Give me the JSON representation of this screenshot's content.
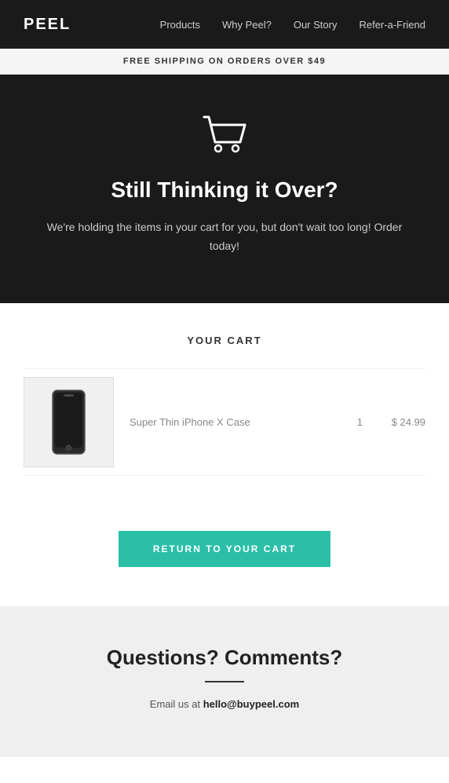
{
  "header": {
    "logo": "PEEL",
    "nav": {
      "items": [
        {
          "label": "Products",
          "href": "#"
        },
        {
          "label": "Why Peel?",
          "href": "#"
        },
        {
          "label": "Our Story",
          "href": "#"
        },
        {
          "label": "Refer-a-Friend",
          "href": "#"
        }
      ]
    }
  },
  "banner": {
    "text": "FREE SHIPPING ON ORDERS OVER $49"
  },
  "hero": {
    "title": "Still Thinking it Over?",
    "subtitle": "We're holding the items in your cart for you, but don't wait too long! Order today!"
  },
  "cart": {
    "section_title": "YOUR CART",
    "items": [
      {
        "name": "Super Thin iPhone X Case",
        "qty": "1",
        "price": "$ 24.99"
      }
    ]
  },
  "cta": {
    "button_label": "RETURN TO YOUR CART"
  },
  "footer": {
    "heading": "Questions? Comments?",
    "text_prefix": "Email us at ",
    "email": "hello@buypeel.com"
  }
}
